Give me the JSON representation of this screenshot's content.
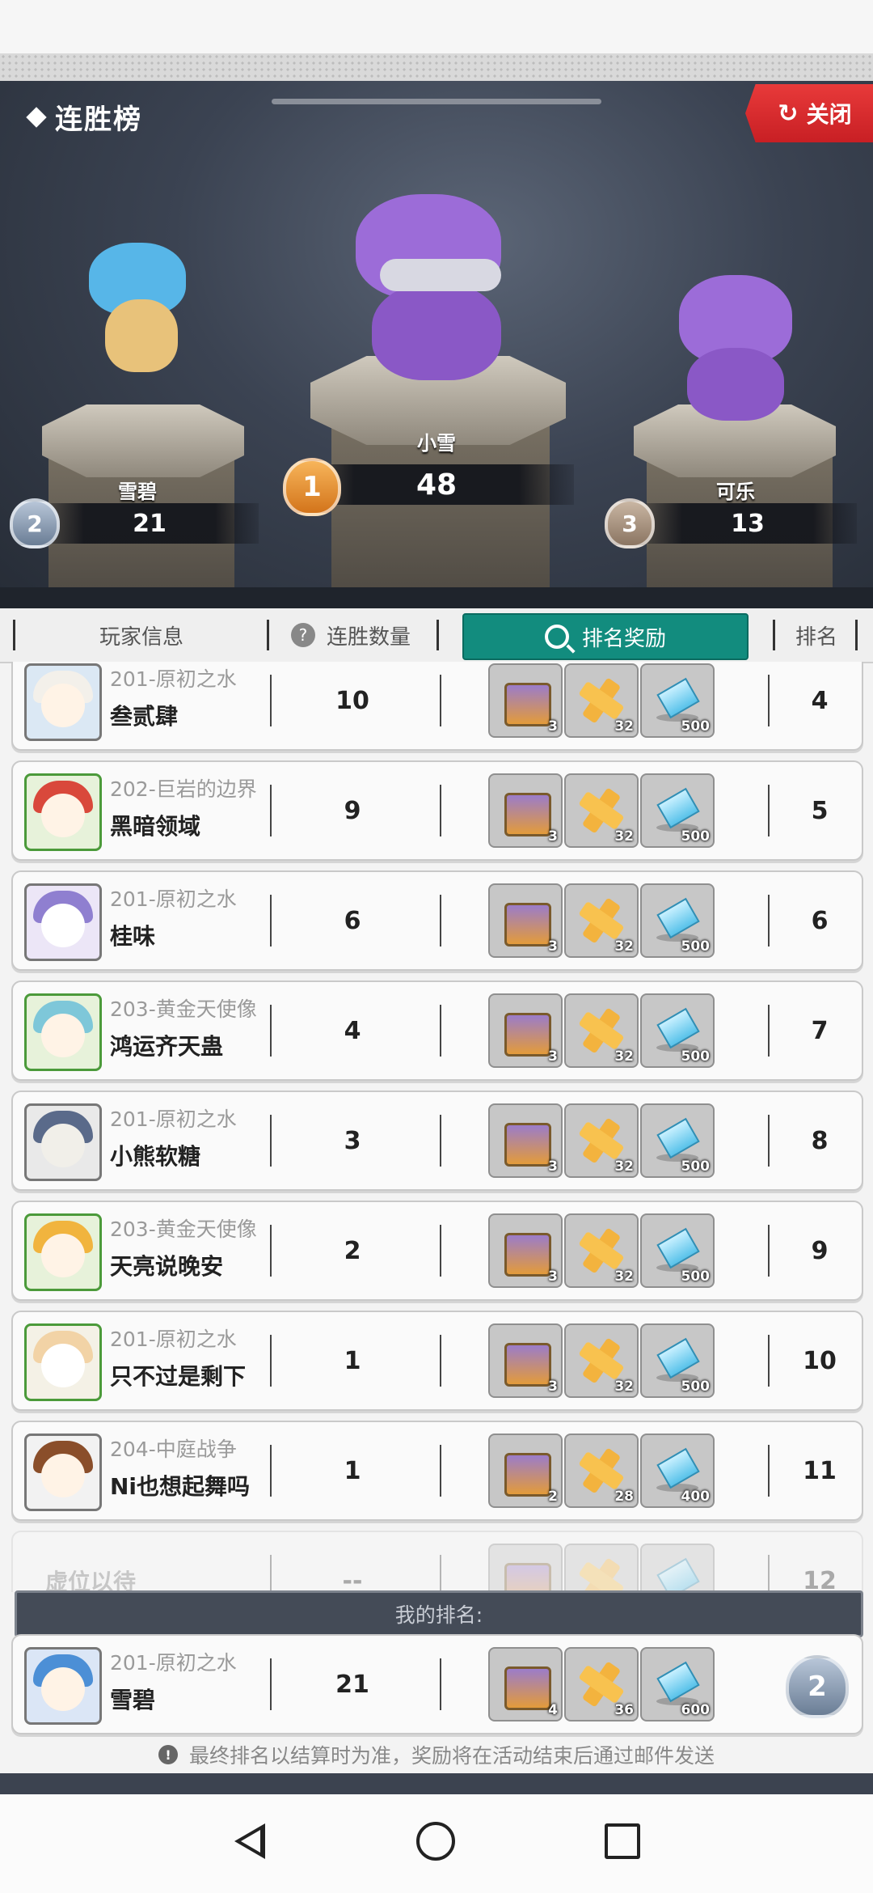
{
  "header": {
    "title": "连胜榜",
    "close_label": "关闭"
  },
  "podium": [
    {
      "place": "1",
      "name": "小雪",
      "score": "48"
    },
    {
      "place": "2",
      "name": "雪碧",
      "score": "21"
    },
    {
      "place": "3",
      "name": "可乐",
      "score": "13"
    }
  ],
  "tabs": {
    "player_info": "玩家信息",
    "streak_count": "连胜数量",
    "rank_rewards": "排名奖励",
    "rank": "排名"
  },
  "rows": [
    {
      "server": "201-原初之水",
      "name": "叁贰肆",
      "count": "10",
      "rewards": [
        "3",
        "32",
        "500"
      ],
      "rank": "4"
    },
    {
      "server": "202-巨岩的边界",
      "name": "黑暗领域",
      "count": "9",
      "rewards": [
        "3",
        "32",
        "500"
      ],
      "rank": "5"
    },
    {
      "server": "201-原初之水",
      "name": "桂味",
      "count": "6",
      "rewards": [
        "3",
        "32",
        "500"
      ],
      "rank": "6"
    },
    {
      "server": "203-黄金天使像",
      "name": "鸿运齐天蛊",
      "count": "4",
      "rewards": [
        "3",
        "32",
        "500"
      ],
      "rank": "7"
    },
    {
      "server": "201-原初之水",
      "name": "小熊软糖",
      "count": "3",
      "rewards": [
        "3",
        "32",
        "500"
      ],
      "rank": "8"
    },
    {
      "server": "203-黄金天使像",
      "name": "天亮说晚安",
      "count": "2",
      "rewards": [
        "3",
        "32",
        "500"
      ],
      "rank": "9"
    },
    {
      "server": "201-原初之水",
      "name": "只不过是剩下",
      "count": "1",
      "rewards": [
        "3",
        "32",
        "500"
      ],
      "rank": "10"
    },
    {
      "server": "204-中庭战争",
      "name": "Ni也想起舞吗",
      "count": "1",
      "rewards": [
        "2",
        "28",
        "400"
      ],
      "rank": "11"
    },
    {
      "server": "",
      "name": "虚位以待",
      "count": "--",
      "rewards": [
        "",
        "",
        ""
      ],
      "rank": "12"
    }
  ],
  "my_rank": {
    "label": "我的排名:",
    "server": "201-原初之水",
    "name": "雪碧",
    "count": "21",
    "rewards": [
      "4",
      "36",
      "600"
    ],
    "rank_badge": "2"
  },
  "footer_note": "最终排名以结算时为准，奖励将在活动结束后通过邮件发送",
  "colors": {
    "accent_teal": "#128c7e",
    "close_red": "#d82a2e",
    "gold": "#e38a2a"
  }
}
